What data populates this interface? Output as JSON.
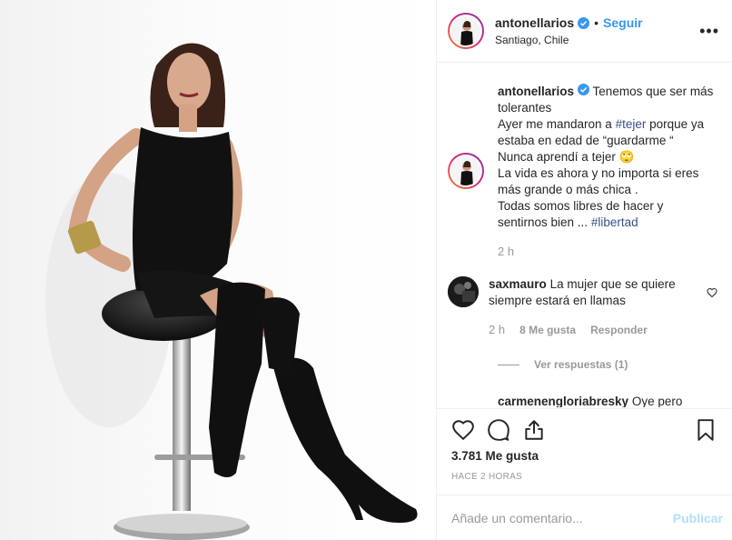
{
  "post": {
    "image_alt": "Mujer con vestido negro y botas altas sentada en un taburete"
  },
  "header": {
    "username": "antonellarios",
    "separator": "•",
    "follow_label": "Seguir",
    "location": "Santiago, Chile",
    "more_label": "•••"
  },
  "caption": {
    "username": "antonellarios",
    "lines": [
      "Tenemos que ser más",
      "tolerantes",
      "Ayer me mandaron a ",
      "#tejer",
      " porque ya",
      "estaba en edad de “guardarme “",
      "Nunca aprendí a tejer 🙄",
      "La vida es ahora y no importa si eres",
      "más grande o más chica .",
      "Todas somos libres de hacer y",
      "sentirnos bien ... ",
      "#libertad"
    ],
    "time": "2 h"
  },
  "comments": [
    {
      "username": "saxmauro",
      "text_1": "La mujer que se quiere",
      "text_2": "siempre estará en llamas",
      "time": "2 h",
      "likes": "8 Me gusta",
      "reply_label": "Responder",
      "view_replies": "Ver respuestas (1)"
    },
    {
      "username": "carmenengloriabresky",
      "text": "Oye pero"
    }
  ],
  "actions": {
    "likes_count": "3.781 Me gusta",
    "posted_ago": "HACE 2 HORAS"
  },
  "add_comment": {
    "placeholder": "Añade un comentario...",
    "publish_label": "Publicar"
  },
  "colors": {
    "link": "#3897f0",
    "hashtag": "#385185",
    "muted": "#999999",
    "publish_disabled": "#b2dffc"
  }
}
